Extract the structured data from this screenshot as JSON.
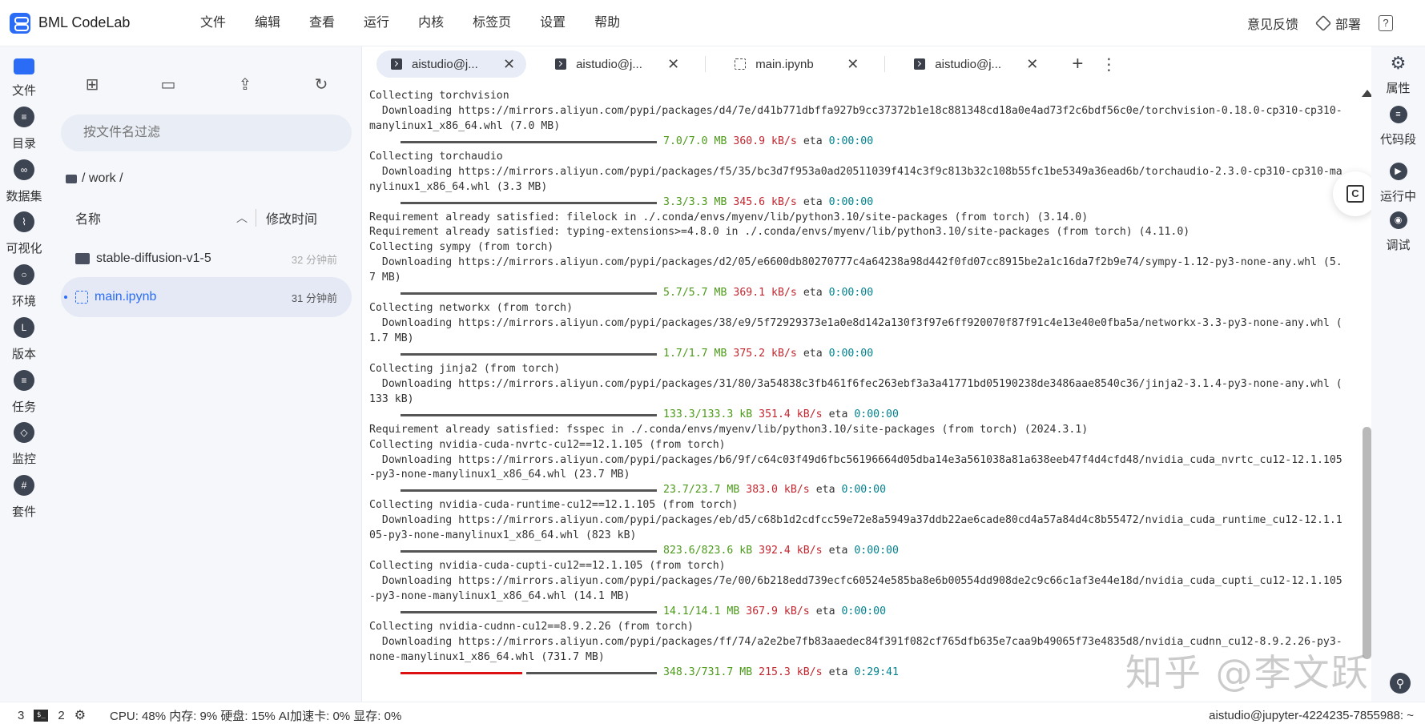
{
  "app": {
    "name": "BML CodeLab"
  },
  "menu": [
    "文件",
    "编辑",
    "查看",
    "运行",
    "内核",
    "标签页",
    "设置",
    "帮助"
  ],
  "top_right": {
    "feedback": "意见反馈",
    "deploy": "部署",
    "help": "?"
  },
  "activity": [
    {
      "label": "文件",
      "icon": "folder-icon",
      "active": true
    },
    {
      "label": "目录",
      "icon": "list-icon"
    },
    {
      "label": "数据集",
      "icon": "dataset-icon"
    },
    {
      "label": "可视化",
      "icon": "chart-icon"
    },
    {
      "label": "环境",
      "icon": "environment-icon"
    },
    {
      "label": "版本",
      "icon": "version-icon"
    },
    {
      "label": "任务",
      "icon": "task-icon"
    },
    {
      "label": "监控",
      "icon": "monitor-icon"
    },
    {
      "label": "套件",
      "icon": "suite-icon"
    }
  ],
  "file_panel": {
    "search_placeholder": "按文件名过滤",
    "breadcrumb": "/ work /",
    "col_name": "名称",
    "col_time": "修改时间",
    "files": [
      {
        "name": "stable-diffusion-v1-5",
        "time": "32 分钟前",
        "type": "folder"
      },
      {
        "name": "main.ipynb",
        "time": "31 分钟前",
        "type": "notebook",
        "selected": true
      }
    ]
  },
  "tabs": [
    {
      "label": "aistudio@j...",
      "type": "terminal",
      "active": true
    },
    {
      "label": "aistudio@j...",
      "type": "terminal"
    },
    {
      "label": "main.ipynb",
      "type": "notebook"
    },
    {
      "label": "aistudio@j...",
      "type": "terminal"
    }
  ],
  "terminal": [
    {
      "t": "text",
      "v": "Collecting torchvision"
    },
    {
      "t": "text",
      "v": "  Downloading https://mirrors.aliyun.com/pypi/packages/d4/7e/d41b771dbffa927b9cc37372b1e18c881348cd18a0e4ad73f2c6bdf56c0e/torchvision-0.18.0-cp310-cp310-"
    },
    {
      "t": "text",
      "v": "manylinux1_x86_64.whl (7.0 MB)"
    },
    {
      "t": "prog",
      "size": "7.0/7.0 MB",
      "speed": "360.9 kB/s",
      "eta": "0:00:00",
      "progress": 1
    },
    {
      "t": "text",
      "v": "Collecting torchaudio"
    },
    {
      "t": "text",
      "v": "  Downloading https://mirrors.aliyun.com/pypi/packages/f5/35/bc3d7f953a0ad20511039f414c3f9c813b32c108b55fc1be5349a36ead6b/torchaudio-2.3.0-cp310-cp310-ma"
    },
    {
      "t": "text",
      "v": "nylinux1_x86_64.whl (3.3 MB)"
    },
    {
      "t": "prog",
      "size": "3.3/3.3 MB",
      "speed": "345.6 kB/s",
      "eta": "0:00:00",
      "progress": 1
    },
    {
      "t": "text",
      "v": "Requirement already satisfied: filelock in ./.conda/envs/myenv/lib/python3.10/site-packages (from torch) (3.14.0)"
    },
    {
      "t": "text",
      "v": "Requirement already satisfied: typing-extensions>=4.8.0 in ./.conda/envs/myenv/lib/python3.10/site-packages (from torch) (4.11.0)"
    },
    {
      "t": "text",
      "v": "Collecting sympy (from torch)"
    },
    {
      "t": "text",
      "v": "  Downloading https://mirrors.aliyun.com/pypi/packages/d2/05/e6600db80270777c4a64238a98d442f0fd07cc8915be2a1c16da7f2b9e74/sympy-1.12-py3-none-any.whl (5."
    },
    {
      "t": "text",
      "v": "7 MB)"
    },
    {
      "t": "prog",
      "size": "5.7/5.7 MB",
      "speed": "369.1 kB/s",
      "eta": "0:00:00",
      "progress": 1
    },
    {
      "t": "text",
      "v": "Collecting networkx (from torch)"
    },
    {
      "t": "text",
      "v": "  Downloading https://mirrors.aliyun.com/pypi/packages/38/e9/5f72929373e1a0e8d142a130f3f97e6ff920070f87f91c4e13e40e0fba5a/networkx-3.3-py3-none-any.whl ("
    },
    {
      "t": "text",
      "v": "1.7 MB)"
    },
    {
      "t": "prog",
      "size": "1.7/1.7 MB",
      "speed": "375.2 kB/s",
      "eta": "0:00:00",
      "progress": 1
    },
    {
      "t": "text",
      "v": "Collecting jinja2 (from torch)"
    },
    {
      "t": "text",
      "v": "  Downloading https://mirrors.aliyun.com/pypi/packages/31/80/3a54838c3fb461f6fec263ebf3a3a41771bd05190238de3486aae8540c36/jinja2-3.1.4-py3-none-any.whl ("
    },
    {
      "t": "text",
      "v": "133 kB)"
    },
    {
      "t": "prog",
      "size": "133.3/133.3 kB",
      "speed": "351.4 kB/s",
      "eta": "0:00:00",
      "progress": 1
    },
    {
      "t": "text",
      "v": "Requirement already satisfied: fsspec in ./.conda/envs/myenv/lib/python3.10/site-packages (from torch) (2024.3.1)"
    },
    {
      "t": "text",
      "v": "Collecting nvidia-cuda-nvrtc-cu12==12.1.105 (from torch)"
    },
    {
      "t": "text",
      "v": "  Downloading https://mirrors.aliyun.com/pypi/packages/b6/9f/c64c03f49d6fbc56196664d05dba14e3a561038a81a638eeb47f4d4cfd48/nvidia_cuda_nvrtc_cu12-12.1.105"
    },
    {
      "t": "text",
      "v": "-py3-none-manylinux1_x86_64.whl (23.7 MB)"
    },
    {
      "t": "prog",
      "size": "23.7/23.7 MB",
      "speed": "383.0 kB/s",
      "eta": "0:00:00",
      "progress": 1
    },
    {
      "t": "text",
      "v": "Collecting nvidia-cuda-runtime-cu12==12.1.105 (from torch)"
    },
    {
      "t": "text",
      "v": "  Downloading https://mirrors.aliyun.com/pypi/packages/eb/d5/c68b1d2cdfcc59e72e8a5949a37ddb22ae6cade80cd4a57a84d4c8b55472/nvidia_cuda_runtime_cu12-12.1.1"
    },
    {
      "t": "text",
      "v": "05-py3-none-manylinux1_x86_64.whl (823 kB)"
    },
    {
      "t": "prog",
      "size": "823.6/823.6 kB",
      "speed": "392.4 kB/s",
      "eta": "0:00:00",
      "progress": 1
    },
    {
      "t": "text",
      "v": "Collecting nvidia-cuda-cupti-cu12==12.1.105 (from torch)"
    },
    {
      "t": "text",
      "v": "  Downloading https://mirrors.aliyun.com/pypi/packages/7e/00/6b218edd739ecfc60524e585ba8e6b00554dd908de2c9c66c1af3e44e18d/nvidia_cuda_cupti_cu12-12.1.105"
    },
    {
      "t": "text",
      "v": "-py3-none-manylinux1_x86_64.whl (14.1 MB)"
    },
    {
      "t": "prog",
      "size": "14.1/14.1 MB",
      "speed": "367.9 kB/s",
      "eta": "0:00:00",
      "progress": 1
    },
    {
      "t": "text",
      "v": "Collecting nvidia-cudnn-cu12==8.9.2.26 (from torch)"
    },
    {
      "t": "text",
      "v": "  Downloading https://mirrors.aliyun.com/pypi/packages/ff/74/a2e2be7fb83aaedec84f391f082cf765dfb635e7caa9b49065f73e4835d8/nvidia_cudnn_cu12-8.9.2.26-py3-"
    },
    {
      "t": "text",
      "v": "none-manylinux1_x86_64.whl (731.7 MB)"
    },
    {
      "t": "prog",
      "size": "348.3/731.7 MB",
      "speed": "215.3 kB/s",
      "eta": "0:29:41",
      "progress": 0.476
    }
  ],
  "rightbar": [
    {
      "label": "属性",
      "icon": "gear-icon"
    },
    {
      "label": "代码段",
      "icon": "snippet-icon"
    },
    {
      "label": "运行中",
      "icon": "running-icon"
    },
    {
      "label": "调试",
      "icon": "debug-icon"
    }
  ],
  "status": {
    "count1": "3",
    "count2": "2",
    "resources": "CPU:  48% 内存:  9% 硬盘:  15% AI加速卡:  0% 显存:  0%",
    "right": "aistudio@jupyter-4224235-7855988: ~"
  },
  "watermark": "知乎 @李文跃",
  "colors": {
    "accent": "#2a6cf6",
    "progress_done": "#4c9a1a",
    "speed": "#c0262f",
    "eta": "#00838f",
    "progress_bar": "#d11"
  }
}
